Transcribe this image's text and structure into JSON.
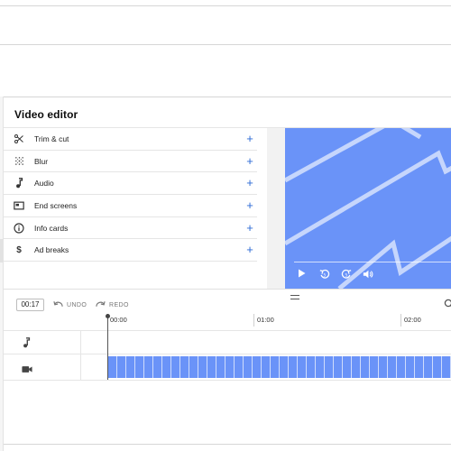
{
  "editor": {
    "title": "Video editor"
  },
  "tools": [
    {
      "label": "Trim & cut",
      "icon": "scissors-icon"
    },
    {
      "label": "Blur",
      "icon": "blur-grid-icon"
    },
    {
      "label": "Audio",
      "icon": "music-note-icon"
    },
    {
      "label": "End screens",
      "icon": "end-screen-icon"
    },
    {
      "label": "Info cards",
      "icon": "info-icon"
    },
    {
      "label": "Ad breaks",
      "icon": "dollar-icon"
    }
  ],
  "timeline": {
    "current_time": "00:17",
    "undo_label": "UNDO",
    "redo_label": "REDO",
    "ruler": [
      "00:00",
      "01:00",
      "02:00"
    ]
  },
  "colors": {
    "accent": "#2d6ad6",
    "video_fill": "#6a93f8",
    "video_stripes": "#cfdcfb"
  }
}
